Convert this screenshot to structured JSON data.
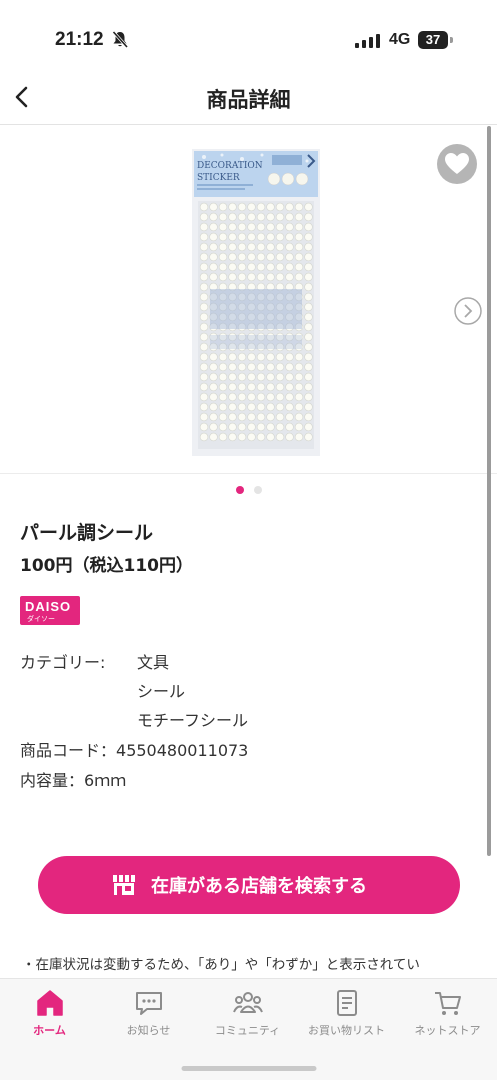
{
  "status_bar": {
    "time": "21:12",
    "network": "4G",
    "battery": "37"
  },
  "nav": {
    "title": "商品詳細"
  },
  "product": {
    "image_text": {
      "line1": "DECORATION",
      "line2": "STICKER"
    },
    "name": "パール調シール",
    "price": "100円（税込110円）",
    "brand": {
      "main": "DAISO",
      "sub": "ダイソー",
      "color": "#e3267e"
    }
  },
  "carousel": {
    "slide_count": 2,
    "active_index": 0
  },
  "details": {
    "category_label": "カテゴリー:",
    "categories": [
      "文具",
      "シール",
      "モチーフシール"
    ],
    "code_label": "商品コード：",
    "code": "4550480011073",
    "capacity_label": "内容量：",
    "capacity": "6ｍｍ"
  },
  "search_button": {
    "label": "在庫がある店舗を検索する"
  },
  "note": "・在庫状況は変動するため、「あり」や「わずか」と表示されてい",
  "tabs": [
    {
      "label": "ホーム",
      "icon": "home-icon",
      "active": true
    },
    {
      "label": "お知らせ",
      "icon": "chat-icon",
      "active": false
    },
    {
      "label": "コミュニティ",
      "icon": "community-icon",
      "active": false
    },
    {
      "label": "お買い物リスト",
      "icon": "list-icon",
      "active": false
    },
    {
      "label": "ネットストア",
      "icon": "cart-icon",
      "active": false
    }
  ],
  "colors": {
    "accent": "#e3267e"
  }
}
